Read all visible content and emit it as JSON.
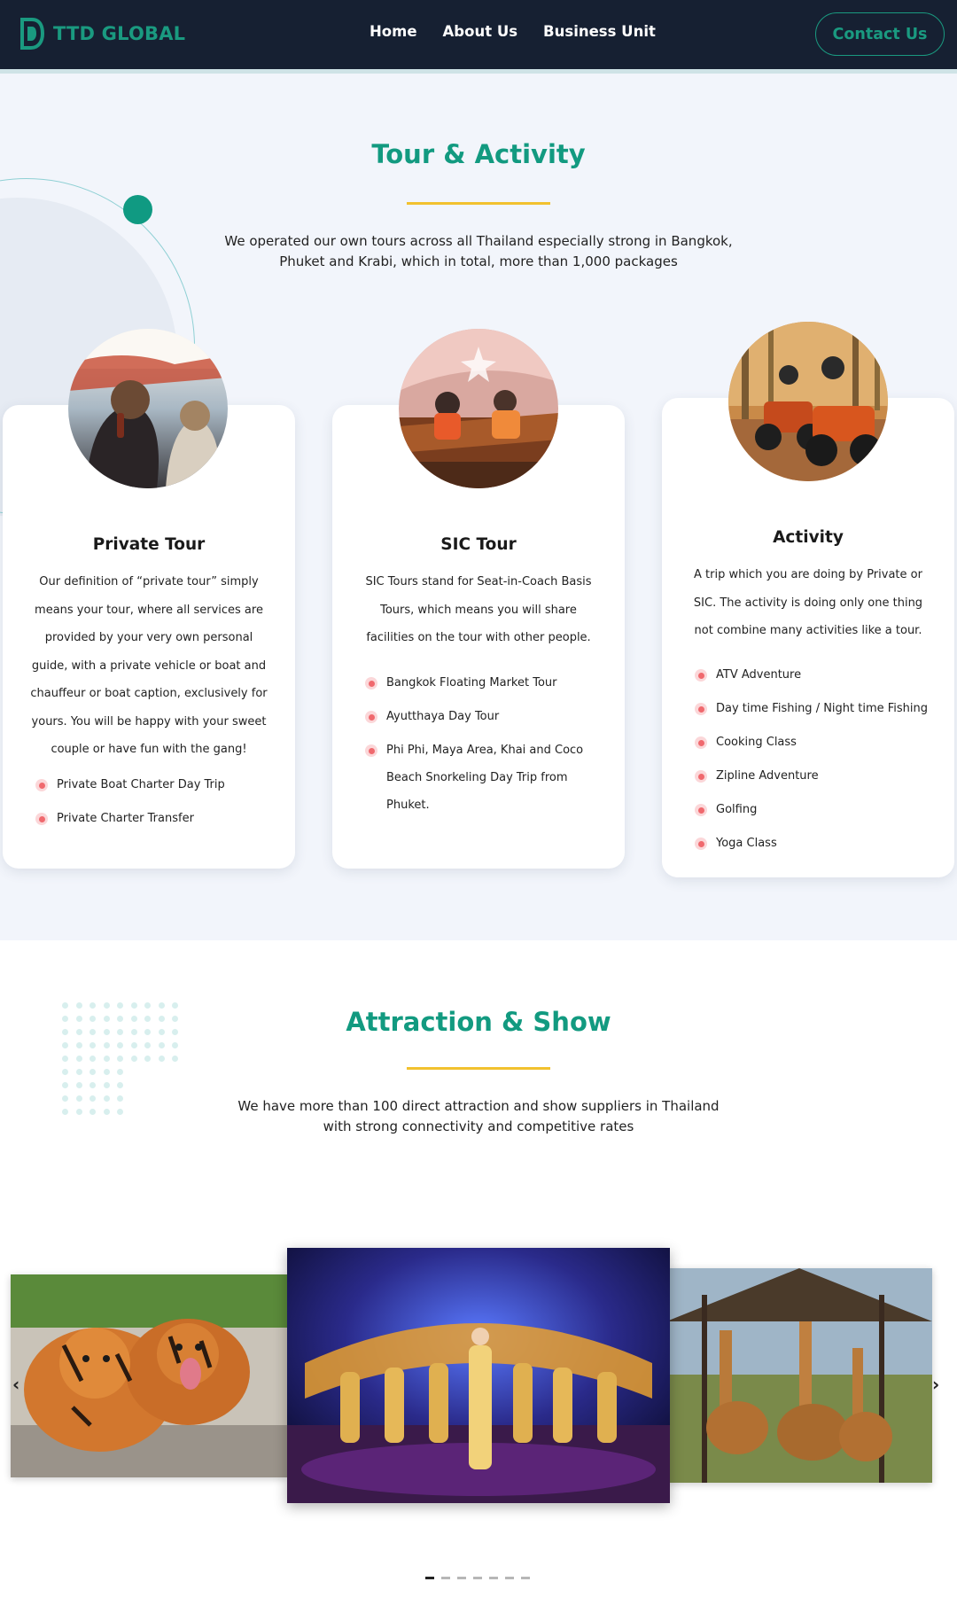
{
  "header": {
    "logo_text": "TTD GLOBAL",
    "nav": [
      "Home",
      "About Us",
      "Business Unit"
    ],
    "contact_label": "Contact Us"
  },
  "tour": {
    "title": "Tour & Activity",
    "desc_line1": "We operated our own tours across all Thailand especially strong in Bangkok,",
    "desc_line2": "Phuket and Krabi, which in total, more than 1,000 packages",
    "cards": [
      {
        "title": "Private Tour",
        "desc": [
          "Our definition of “private tour” simply",
          "means your tour, where all services are",
          "provided by your very own personal",
          "guide, with a private vehicle or boat and",
          "chauffeur or boat caption, exclusively for",
          "yours. You will be happy with your sweet",
          "couple or have fun with the gang!"
        ],
        "items": [
          "Private Boat Charter Day Trip",
          "Private Charter Transfer"
        ]
      },
      {
        "title": "SIC Tour",
        "desc": [
          "SIC Tours stand for Seat-in-Coach Basis",
          "Tours, which means you will share",
          "facilities on the tour with other people."
        ],
        "items": [
          "Bangkok Floating Market Tour",
          "Ayutthaya Day Tour",
          "Phi Phi, Maya Area, Khai and Coco Beach Snorkeling Day Trip from Phuket."
        ]
      },
      {
        "title": "Activity",
        "desc": [
          "A trip which you are doing by Private or",
          "SIC. The activity is doing only one thing",
          "not combine many activities like a tour."
        ],
        "items": [
          "ATV Adventure",
          "Day time Fishing / Night time Fishing",
          "Cooking Class",
          "Zipline Adventure",
          "Golfing",
          "Yoga Class"
        ]
      }
    ]
  },
  "attraction": {
    "title": "Attraction & Show",
    "desc_line1": "We have more than 100 direct attraction and show suppliers in Thailand",
    "desc_line2": "with strong connectivity and competitive rates",
    "prev_arrow": "‹",
    "next_arrow": "›",
    "active_slide": 1,
    "slide_count": 7
  },
  "colors": {
    "header_bg": "#162032",
    "accent_green": "#129a80",
    "title_underline": "#f2c12e",
    "bullet": "#f0696e",
    "section_bg": "#f2f5fb"
  }
}
